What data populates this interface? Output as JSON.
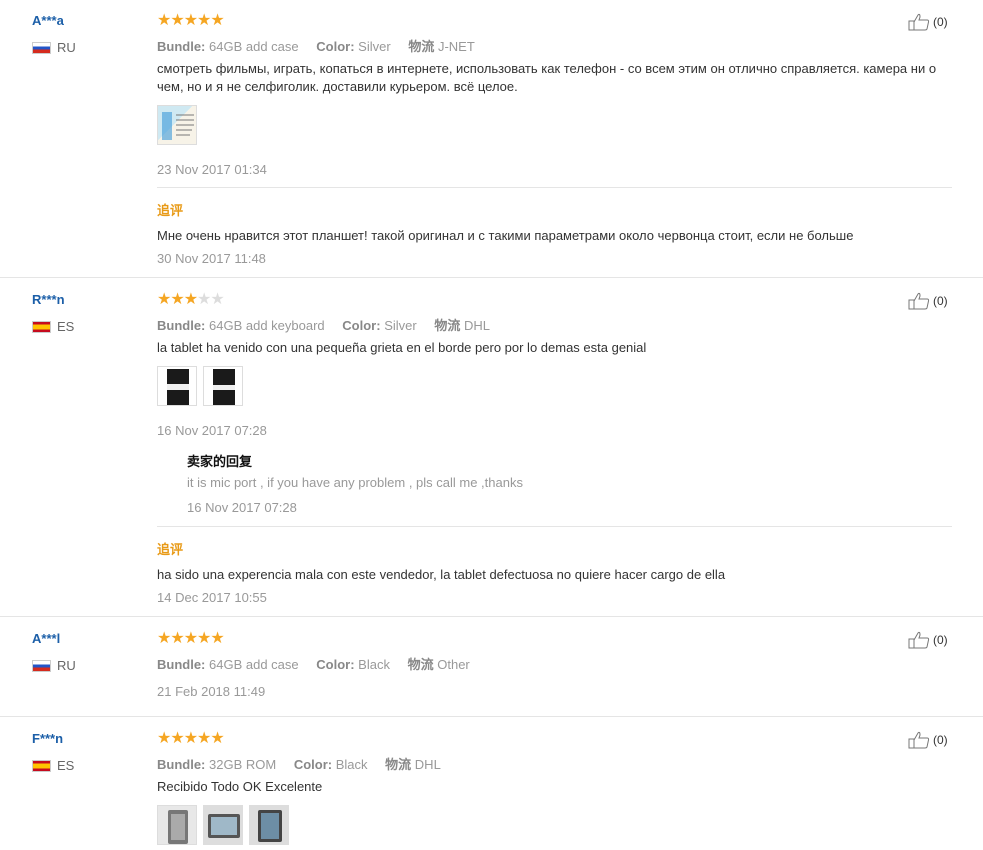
{
  "labels": {
    "bundle": "Bundle:",
    "color": "Color:",
    "shipping": "物流",
    "additional_feedback": "追评",
    "seller_reply": "卖家的回复"
  },
  "colors": {
    "username": "#1c5fa8",
    "star": "#f5a623",
    "additional": "#e89a17"
  },
  "reviews": [
    {
      "user": "A***a",
      "country": "RU",
      "flag": "ru-flag-icon",
      "stars": 5,
      "bundle": "64GB add case",
      "color": "Silver",
      "shipping": "J-NET",
      "text": "смотреть фильмы, играть, копаться в интернете, использовать как телефон - со всем этим он отлично справляется. камера ни о чем, но и я не селфиголик. доставили курьером. всё целое.",
      "photos": 1,
      "date": "23 Nov 2017 01:34",
      "helpful": "(0)",
      "additional": {
        "text": "Мне очень нравится этот планшет! такой оригинал и с такими параметрами около червонца стоит, если не больше",
        "date": "30 Nov 2017 11:48"
      }
    },
    {
      "user": "R***n",
      "country": "ES",
      "flag": "es-flag-icon",
      "stars": 3,
      "bundle": "64GB add keyboard",
      "color": "Silver",
      "shipping": "DHL",
      "text": "la tablet ha venido con una pequeña grieta en el borde pero por lo demas esta genial",
      "photos": 2,
      "date": "16 Nov 2017 07:28",
      "helpful": "(0)",
      "seller_reply": {
        "text": "it is mic port , if you have any problem , pls call me ,thanks",
        "date": "16 Nov 2017 07:28"
      },
      "additional": {
        "text": "ha sido una experencia mala con este vendedor, la tablet defectuosa no quiere hacer cargo de ella",
        "date": "14 Dec 2017 10:55"
      }
    },
    {
      "user": "A***l",
      "country": "RU",
      "flag": "ru-flag-icon",
      "stars": 5,
      "bundle": "64GB add case",
      "color": "Black",
      "shipping": "Other",
      "date": "21 Feb 2018 11:49",
      "helpful": "(0)"
    },
    {
      "user": "F***n",
      "country": "ES",
      "flag": "es-flag-icon",
      "stars": 5,
      "bundle": "32GB ROM",
      "color": "Black",
      "shipping": "DHL",
      "text": "Recibido Todo OK Excelente",
      "photos": 3,
      "helpful": "(0)"
    }
  ]
}
